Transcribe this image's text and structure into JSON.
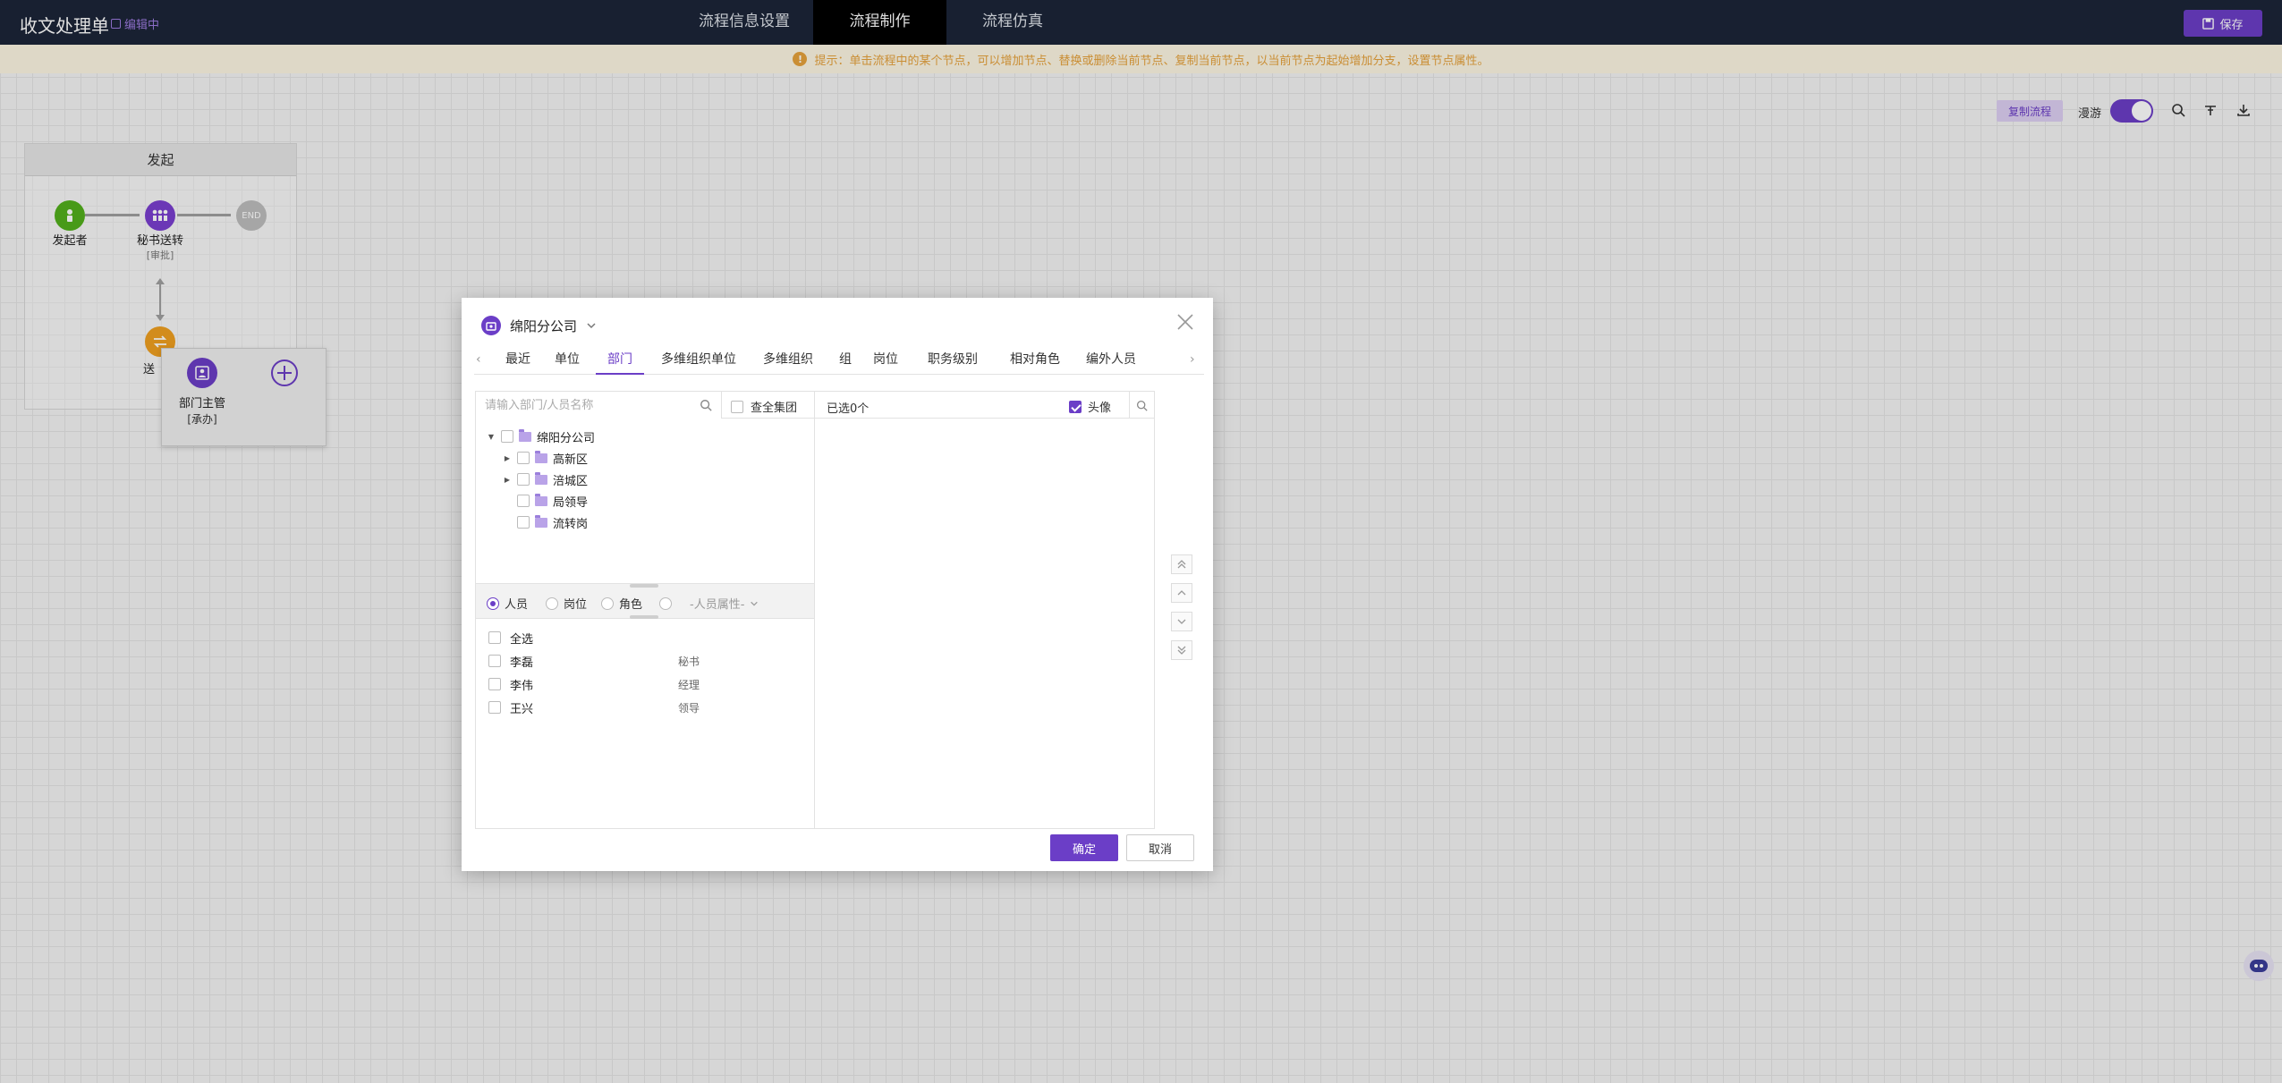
{
  "header": {
    "title": "收文处理单",
    "tag": "编辑中",
    "tabs": [
      {
        "label": "流程信息设置"
      },
      {
        "label": "流程制作"
      },
      {
        "label": "流程仿真"
      }
    ],
    "save_label": "保存"
  },
  "hint": "提示：单击流程中的某个节点，可以增加节点、替换或删除当前节点、复制当前节点，以当前节点为起始增加分支，设置节点属性。",
  "toolbar": {
    "copy_flow": "复制流程",
    "roam_label": "漫游",
    "roam_on": true
  },
  "flow": {
    "lane_title": "发起",
    "nodes": [
      {
        "label": "发起者",
        "sub": ""
      },
      {
        "label": "秘书送转",
        "sub": "[审批]"
      },
      {
        "label": "END",
        "sub": ""
      },
      {
        "label": "送",
        "sub": ""
      }
    ],
    "popup": {
      "label": "部门主管",
      "sub": "[承办]"
    }
  },
  "modal": {
    "org_name": "绵阳分公司",
    "tabs": [
      "最近",
      "单位",
      "部门",
      "多维组织单位",
      "多维组织",
      "组",
      "岗位",
      "职务级别",
      "相对角色",
      "编外人员"
    ],
    "active_tab": "部门",
    "search_placeholder": "请输入部门/人员名称",
    "whole_group": "查全集团",
    "tree": {
      "root": "绵阳分公司",
      "children": [
        {
          "label": "高新区",
          "expandable": true
        },
        {
          "label": "涪城区",
          "expandable": true
        },
        {
          "label": "局领导",
          "expandable": false
        },
        {
          "label": "流转岗",
          "expandable": false
        }
      ]
    },
    "types": {
      "person": "人员",
      "position": "岗位",
      "role": "角色",
      "attr_placeholder": "-人员属性-"
    },
    "people": {
      "select_all": "全选",
      "list": [
        {
          "name": "李磊",
          "position": "秘书"
        },
        {
          "name": "李伟",
          "position": "经理"
        },
        {
          "name": "王兴",
          "position": "领导"
        }
      ]
    },
    "selected_text": "已选0个",
    "avatar_label": "头像",
    "avatar_checked": true,
    "confirm": "确定",
    "cancel": "取消"
  },
  "colors": {
    "accent": "#6b3ec7",
    "topbar": "#1c2538",
    "start_node": "#52b01c",
    "approve_node": "#7a3fd0",
    "end_node": "#bdbdbd",
    "branch_node": "#f0a020",
    "hint_text": "#e6a23c"
  }
}
